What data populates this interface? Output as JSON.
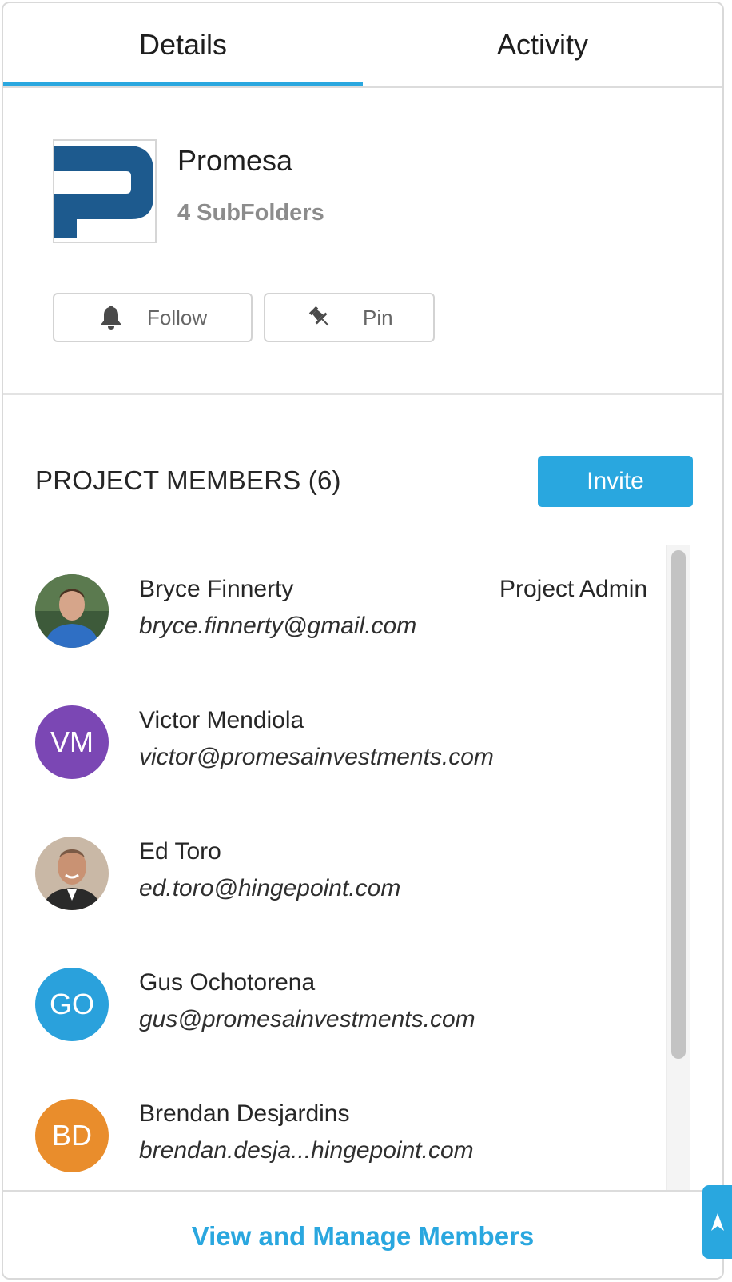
{
  "tabs": {
    "details": "Details",
    "activity": "Activity",
    "active": "details"
  },
  "project": {
    "name": "Promesa",
    "subfolders": "4 SubFolders",
    "logo_icon": "promesa-p-logo",
    "brand_color": "#1d5a8e"
  },
  "actions": {
    "follow_label": "Follow",
    "follow_icon": "bell-icon",
    "pin_label": "Pin",
    "pin_icon": "pushpin-icon"
  },
  "members": {
    "title": "PROJECT MEMBERS (6)",
    "invite_label": "Invite",
    "list": [
      {
        "name": "Bryce Finnerty",
        "email": "bryce.finnerty@gmail.com",
        "role": "Project Admin",
        "avatar": "photo",
        "initials": "",
        "color": "#3a5a3a"
      },
      {
        "name": "Victor Mendiola",
        "email": "victor@promesainvestments.com",
        "role": "",
        "avatar": "initials",
        "initials": "VM",
        "color": "#7b47b4"
      },
      {
        "name": "Ed Toro",
        "email": "ed.toro@hingepoint.com",
        "role": "",
        "avatar": "photo",
        "initials": "",
        "color": "#a8856a"
      },
      {
        "name": "Gus Ochotorena",
        "email": "gus@promesainvestments.com",
        "role": "",
        "avatar": "initials",
        "initials": "GO",
        "color": "#2aa1dc"
      },
      {
        "name": "Brendan Desjardins",
        "email": "brendan.desja...hingepoint.com",
        "role": "",
        "avatar": "initials",
        "initials": "BD",
        "color": "#e98d2c"
      }
    ]
  },
  "footer": {
    "manage_label": "View and Manage Members"
  },
  "colors": {
    "accent": "#29a7df",
    "text": "#262626",
    "muted": "#8c8c8c"
  }
}
